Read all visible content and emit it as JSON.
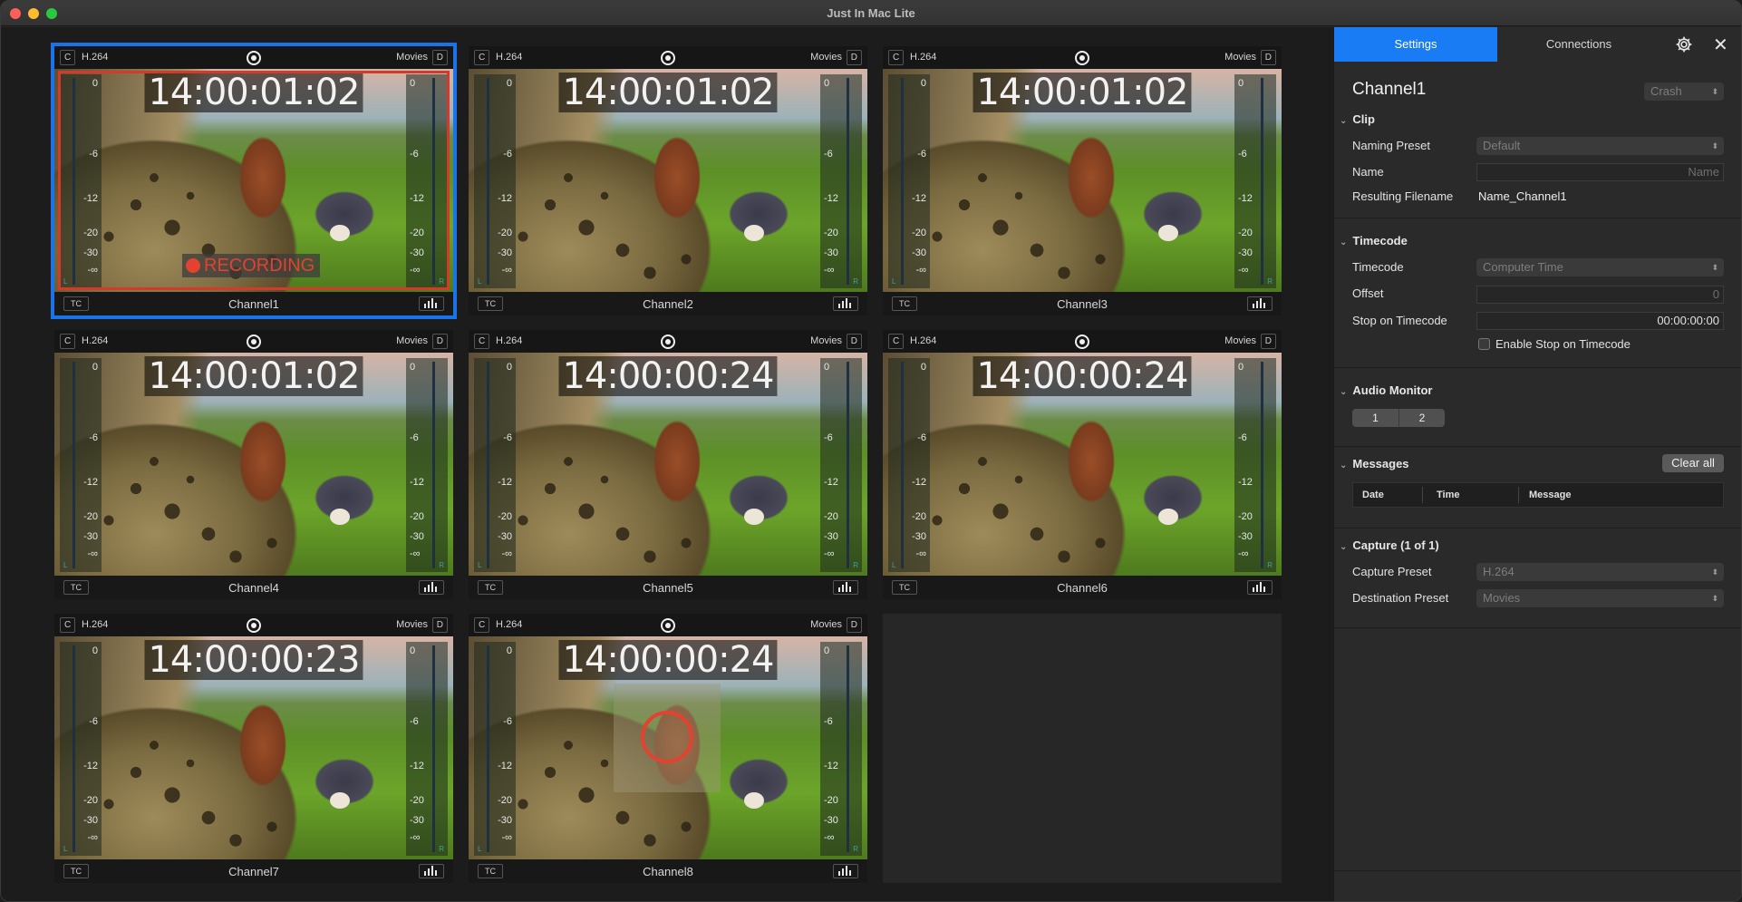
{
  "window": {
    "title": "Just In Mac Lite"
  },
  "channels": [
    {
      "name": "Channel1",
      "codec": "H.264",
      "destination": "Movies",
      "left_chip": "C",
      "right_chip": "D",
      "timecode": "14:00:01:02",
      "recording": true,
      "recording_label": "RECORDING",
      "selected": true
    },
    {
      "name": "Channel2",
      "codec": "H.264",
      "destination": "Movies",
      "left_chip": "C",
      "right_chip": "D",
      "timecode": "14:00:01:02"
    },
    {
      "name": "Channel3",
      "codec": "H.264",
      "destination": "Movies",
      "left_chip": "C",
      "right_chip": "D",
      "timecode": "14:00:01:02"
    },
    {
      "name": "Channel4",
      "codec": "H.264",
      "destination": "Movies",
      "left_chip": "C",
      "right_chip": "D",
      "timecode": "14:00:01:02"
    },
    {
      "name": "Channel5",
      "codec": "H.264",
      "destination": "Movies",
      "left_chip": "C",
      "right_chip": "D",
      "timecode": "14:00:00:24"
    },
    {
      "name": "Channel6",
      "codec": "H.264",
      "destination": "Movies",
      "left_chip": "C",
      "right_chip": "D",
      "timecode": "14:00:00:24"
    },
    {
      "name": "Channel7",
      "codec": "H.264",
      "destination": "Movies",
      "left_chip": "C",
      "right_chip": "D",
      "timecode": "14:00:00:23"
    },
    {
      "name": "Channel8",
      "codec": "H.264",
      "destination": "Movies",
      "left_chip": "C",
      "right_chip": "D",
      "timecode": "14:00:00:24",
      "loading": true
    }
  ],
  "tile_labels": {
    "tc_button": "TC"
  },
  "meter_scale": [
    "0",
    "-6",
    "-12",
    "-20",
    "-30",
    "-∞"
  ],
  "meter_corner_labels": {
    "left": "L",
    "right": "R"
  },
  "panel": {
    "tabs": [
      "Settings",
      "Connections"
    ],
    "active_tab": "Settings",
    "channel_title": "Channel1",
    "channel_menu": "Crash",
    "clip": {
      "title": "Clip",
      "naming_preset_label": "Naming Preset",
      "naming_preset_value": "Default",
      "name_label": "Name",
      "name_placeholder": "Name",
      "resulting_label": "Resulting Filename",
      "resulting_value": "Name_Channel1"
    },
    "timecode": {
      "title": "Timecode",
      "timecode_label": "Timecode",
      "timecode_value": "Computer Time",
      "offset_label": "Offset",
      "offset_value": "0",
      "stop_label": "Stop on Timecode",
      "stop_value": "00:00:00:00",
      "enable_label": "Enable Stop on Timecode"
    },
    "audio": {
      "title": "Audio Monitor",
      "options": [
        "1",
        "2"
      ]
    },
    "messages": {
      "title": "Messages",
      "clear_label": "Clear all",
      "columns": [
        "Date",
        "Time",
        "Message"
      ]
    },
    "capture": {
      "title": "Capture (1 of 1)",
      "capture_label": "Capture Preset",
      "capture_value": "H.264",
      "dest_label": "Destination Preset",
      "dest_value": "Movies"
    }
  },
  "colors": {
    "accent": "#1a7cf5",
    "recording": "#e2422f",
    "selection": "#1a73e8"
  },
  "icons": {
    "gear": "gear-icon",
    "close": "close-icon",
    "record": "record-icon",
    "levels": "audio-levels-icon"
  }
}
